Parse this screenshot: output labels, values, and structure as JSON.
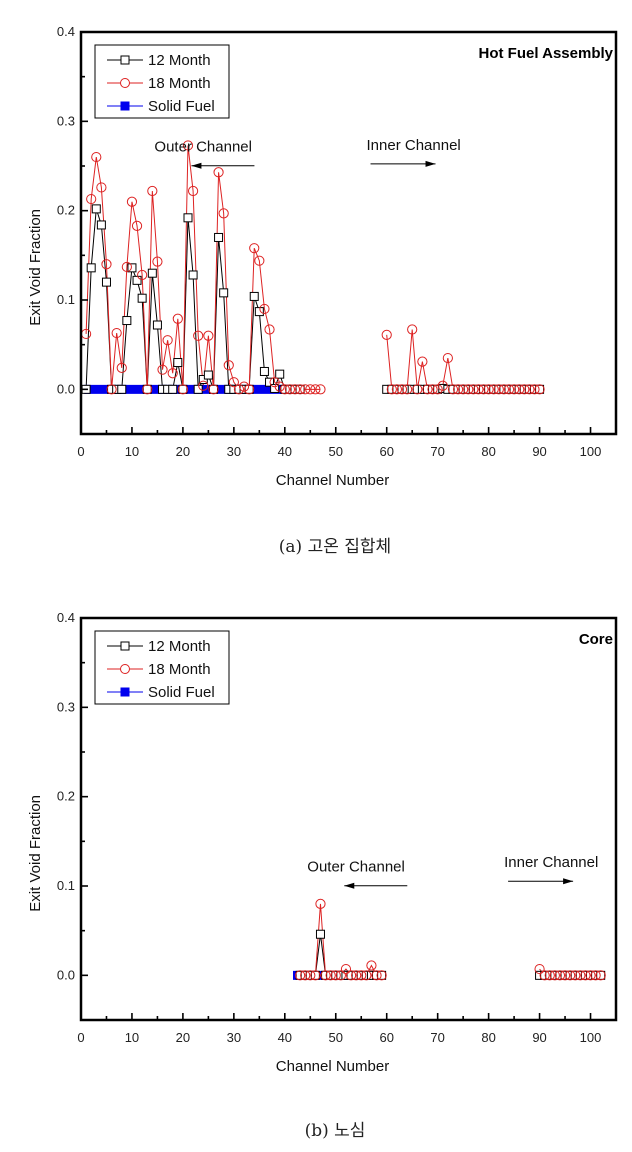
{
  "chart_data": [
    {
      "type": "line",
      "panel_title": "Hot Fuel Assembly",
      "caption": "(a)  고온  집합체",
      "xlabel": "Channel Number",
      "ylabel": "Exit Void Fraction",
      "xlim": [
        0,
        105
      ],
      "ylim": [
        -0.05,
        0.4
      ],
      "xticks": [
        0,
        10,
        20,
        30,
        40,
        50,
        60,
        70,
        80,
        90,
        100
      ],
      "xtick_labels": [
        "0",
        "10",
        "20",
        "30",
        "40",
        "50",
        "60",
        "70",
        "80",
        "90",
        "100"
      ],
      "yticks": [
        0.0,
        0.1,
        0.2,
        0.3,
        0.4
      ],
      "ytick_labels": [
        "0.0",
        "0.1",
        "0.2",
        "0.3",
        "0.4"
      ],
      "grid": false,
      "legend": {
        "position": "top-left",
        "entries": [
          "12 Month",
          "18 Month",
          "Solid Fuel"
        ]
      },
      "annotations": [
        {
          "text": "Outer Channel",
          "arrow": "left",
          "x": 36,
          "y": 0.266
        },
        {
          "text": "Inner Channel",
          "arrow": "right",
          "x": 58,
          "y": 0.268
        }
      ],
      "series": [
        {
          "name": "12 Month",
          "color": "#000000",
          "marker": "square-open",
          "segments": [
            {
              "x": [
                1,
                2,
                3,
                4,
                5,
                6,
                7,
                8,
                9,
                10,
                11,
                12,
                13,
                14,
                15,
                16,
                17,
                18,
                19,
                20,
                21,
                22,
                23,
                24,
                25,
                26,
                27,
                28,
                29,
                30,
                31,
                32,
                33,
                34,
                35,
                36,
                37,
                38,
                39,
                40,
                41,
                42,
                43
              ],
              "y": [
                0,
                0.136,
                0.202,
                0.184,
                0.12,
                0,
                0,
                0,
                0.077,
                0.136,
                0.122,
                0.102,
                0,
                0.13,
                0.072,
                0,
                0,
                0,
                0.03,
                0,
                0.192,
                0.128,
                0,
                0.011,
                0.016,
                0,
                0.17,
                0.108,
                0,
                0,
                0,
                0,
                0,
                0.104,
                0.087,
                0.02,
                0.008,
                0.001,
                0.017,
                0,
                0,
                0,
                0
              ]
            },
            {
              "x": [
                60,
                61,
                62,
                63,
                64,
                65,
                66,
                67,
                68,
                69,
                70,
                71,
                72,
                73,
                74,
                75,
                76,
                77,
                78,
                79,
                80,
                81,
                82,
                83,
                84,
                85,
                86,
                87,
                88,
                89,
                90
              ],
              "y": [
                0,
                0,
                0,
                0,
                0,
                0,
                0,
                0,
                0,
                0,
                0,
                0.001,
                0,
                0,
                0,
                0,
                0,
                0,
                0,
                0,
                0,
                0,
                0,
                0,
                0,
                0,
                0,
                0,
                0,
                0,
                0
              ]
            }
          ]
        },
        {
          "name": "18 Month",
          "color": "#dd2222",
          "marker": "circle-open",
          "segments": [
            {
              "x": [
                1,
                2,
                3,
                4,
                5,
                6,
                7,
                8,
                9,
                10,
                11,
                12,
                13,
                14,
                15,
                16,
                17,
                18,
                19,
                20,
                21,
                22,
                23,
                24,
                25,
                26,
                27,
                28,
                29,
                30,
                31,
                32,
                33,
                34,
                35,
                36,
                37,
                38,
                39,
                40,
                41,
                42,
                43,
                44,
                45,
                46,
                47
              ],
              "y": [
                0.062,
                0.213,
                0.26,
                0.226,
                0.14,
                0,
                0.063,
                0.024,
                0.137,
                0.21,
                0.183,
                0.128,
                0,
                0.222,
                0.143,
                0.022,
                0.055,
                0.018,
                0.079,
                0,
                0.273,
                0.222,
                0.06,
                0.004,
                0.06,
                0,
                0.243,
                0.197,
                0.027,
                0.008,
                0,
                0.003,
                0,
                0.158,
                0.144,
                0.09,
                0.067,
                0.008,
                0.003,
                0,
                0,
                0,
                0,
                0,
                0,
                0,
                0
              ]
            },
            {
              "x": [
                60,
                61,
                62,
                63,
                64,
                65,
                66,
                67,
                68,
                69,
                70,
                71,
                72,
                73,
                74,
                75,
                76,
                77,
                78,
                79,
                80,
                81,
                82,
                83,
                84,
                85,
                86,
                87,
                88,
                89,
                90
              ],
              "y": [
                0.061,
                0,
                0,
                0,
                0,
                0.067,
                0,
                0.031,
                0,
                0,
                0,
                0.004,
                0.035,
                0,
                0,
                0,
                0,
                0,
                0,
                0,
                0,
                0,
                0,
                0,
                0,
                0,
                0,
                0,
                0,
                0,
                0
              ]
            }
          ]
        },
        {
          "name": "Solid Fuel",
          "color": "#0000ee",
          "marker": "square-filled",
          "segments": [
            {
              "x": [
                1,
                43
              ],
              "y": [
                0,
                0
              ]
            }
          ]
        }
      ]
    },
    {
      "type": "line",
      "panel_title": "Core",
      "caption": "(b)  노심",
      "xlabel": "Channel Number",
      "ylabel": "Exit Void Fraction",
      "xlim": [
        0,
        105
      ],
      "ylim": [
        -0.05,
        0.4
      ],
      "xticks": [
        0,
        10,
        20,
        30,
        40,
        50,
        60,
        70,
        80,
        90,
        100
      ],
      "xtick_labels": [
        "0",
        "10",
        "20",
        "30",
        "40",
        "50",
        "60",
        "70",
        "80",
        "90",
        "100"
      ],
      "yticks": [
        0.0,
        0.1,
        0.2,
        0.3,
        0.4
      ],
      "ytick_labels": [
        "0.0",
        "0.1",
        "0.2",
        "0.3",
        "0.4"
      ],
      "grid": false,
      "legend": {
        "position": "top-left",
        "entries": [
          "12 Month",
          "18 Month",
          "Solid Fuel"
        ]
      },
      "annotations": [
        {
          "text": "Outer Channel",
          "arrow": "left",
          "x": 66,
          "y": 0.116
        },
        {
          "text": "Inner Channel",
          "arrow": "right",
          "x": 85,
          "y": 0.121
        }
      ],
      "series": [
        {
          "name": "12 Month",
          "color": "#000000",
          "marker": "square-open",
          "segments": [
            {
              "x": [
                43,
                44,
                45,
                46,
                47,
                48,
                49,
                50,
                51,
                52,
                53,
                54,
                55,
                56,
                57,
                58,
                59
              ],
              "y": [
                0,
                0,
                0,
                0,
                0.046,
                0,
                0,
                0,
                0,
                0,
                0,
                0,
                0,
                0,
                0,
                0,
                0
              ]
            },
            {
              "x": [
                90,
                91,
                92,
                93,
                94,
                95,
                96,
                97,
                98,
                99,
                100,
                101,
                102
              ],
              "y": [
                0,
                0,
                0,
                0,
                0,
                0,
                0,
                0,
                0,
                0,
                0,
                0,
                0
              ]
            }
          ]
        },
        {
          "name": "18 Month",
          "color": "#dd2222",
          "marker": "circle-open",
          "segments": [
            {
              "x": [
                43,
                44,
                45,
                46,
                47,
                48,
                49,
                50,
                51,
                52,
                53,
                54,
                55,
                56,
                57,
                58,
                59
              ],
              "y": [
                0,
                0,
                0,
                0,
                0.08,
                0,
                0,
                0,
                0,
                0.007,
                0,
                0,
                0,
                0,
                0.011,
                0,
                0
              ]
            },
            {
              "x": [
                90,
                91,
                92,
                93,
                94,
                95,
                96,
                97,
                98,
                99,
                100,
                101,
                102
              ],
              "y": [
                0.007,
                0,
                0,
                0,
                0,
                0,
                0,
                0,
                0,
                0,
                0,
                0,
                0
              ]
            }
          ]
        },
        {
          "name": "Solid Fuel",
          "color": "#0000ee",
          "marker": "square-filled",
          "segments": [
            {
              "x": [
                42,
                52
              ],
              "y": [
                0,
                0
              ]
            }
          ]
        }
      ]
    }
  ]
}
